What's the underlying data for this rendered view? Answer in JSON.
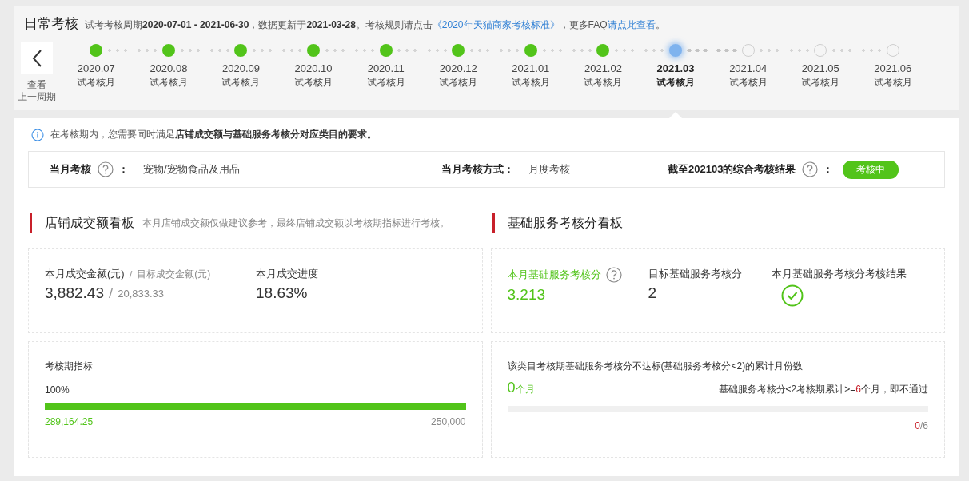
{
  "header": {
    "title": "日常考核",
    "description": [
      {
        "kind": "plain",
        "text": "试考考核周期"
      },
      {
        "kind": "bold",
        "text": "2020-07-01 - 2021-06-30"
      },
      {
        "kind": "plain",
        "text": "，数据更新于"
      },
      {
        "kind": "bold",
        "text": "2021-03-28"
      },
      {
        "kind": "plain",
        "text": "。考核规则请点击"
      },
      {
        "kind": "link",
        "text": "《2020年天猫商家考核标准》"
      },
      {
        "kind": "plain",
        "text": "，更多FAQ"
      },
      {
        "kind": "link",
        "text": "请点此查看"
      },
      {
        "kind": "plain",
        "text": "。"
      }
    ]
  },
  "previous_cycle": {
    "label_lines": [
      "查看",
      "上一周期"
    ]
  },
  "timeline": [
    {
      "month": "2020.07",
      "label": "试考核月",
      "completed": true,
      "selected": false
    },
    {
      "month": "2020.08",
      "label": "试考核月",
      "completed": true,
      "selected": false
    },
    {
      "month": "2020.09",
      "label": "试考核月",
      "completed": true,
      "selected": false
    },
    {
      "month": "2020.10",
      "label": "试考核月",
      "completed": true,
      "selected": false
    },
    {
      "month": "2020.11",
      "label": "试考核月",
      "completed": true,
      "selected": false
    },
    {
      "month": "2020.12",
      "label": "试考核月",
      "completed": true,
      "selected": false
    },
    {
      "month": "2021.01",
      "label": "试考核月",
      "completed": true,
      "selected": false
    },
    {
      "month": "2021.02",
      "label": "试考核月",
      "completed": true,
      "selected": false
    },
    {
      "month": "2021.03",
      "label": "试考核月",
      "completed": false,
      "selected": true
    },
    {
      "month": "2021.04",
      "label": "试考核月",
      "completed": false,
      "selected": false
    },
    {
      "month": "2021.05",
      "label": "试考核月",
      "completed": false,
      "selected": false
    },
    {
      "month": "2021.06",
      "label": "试考核月",
      "completed": false,
      "selected": false
    }
  ],
  "notice": "在考核期内，您需要同时满足**店铺成交额与基础服务考核分对应类目的要求。**",
  "summary": {
    "category_label": "当月考核",
    "category_colon": "：",
    "result_colon": "：",
    "category_value": "宠物/宠物食品及用品",
    "method_label": "当月考核方式：",
    "method_value": "月度考核",
    "result_label": "截至202103的综合考核结果",
    "result_badge": "考核中"
  },
  "sales_board": {
    "title": "店铺成交额看板",
    "note": "本月店铺成交额仅做建议参考，最终店铺成交额以考核期指标进行考核。",
    "amount_label": "本月成交金额(元)",
    "target_label": "目标成交金额(元)",
    "label_separator": "/",
    "value_separator": "/",
    "amount": "3,882.43",
    "target": "20,833.33",
    "progress_label": "本月成交进度",
    "progress": "18.63%",
    "period": {
      "title": "考核期指标",
      "percent": "100%",
      "level": 1,
      "current": "289,164.25",
      "goal": "250,000"
    }
  },
  "service_board": {
    "title": "基础服务考核分看板",
    "score_label": "本月基础服务考核分",
    "score": "3.213",
    "target_label": "目标基础服务考核分",
    "target": "2",
    "result_label": "本月基础服务考核分考核结果",
    "passed": true,
    "failing": {
      "title": "该类目考核期基础服务考核分不达标(基础服务考核分<2)的累计月份数",
      "count": "0",
      "unit": "个月",
      "rule": [
        {
          "kind": "plain",
          "text": "基础服务考核分<2考核期累计>="
        },
        {
          "kind": "highlight",
          "text": "6"
        },
        {
          "kind": "plain",
          "text": "个月，即不通过"
        }
      ],
      "level": 0,
      "used": "0",
      "total": "/6"
    }
  }
}
